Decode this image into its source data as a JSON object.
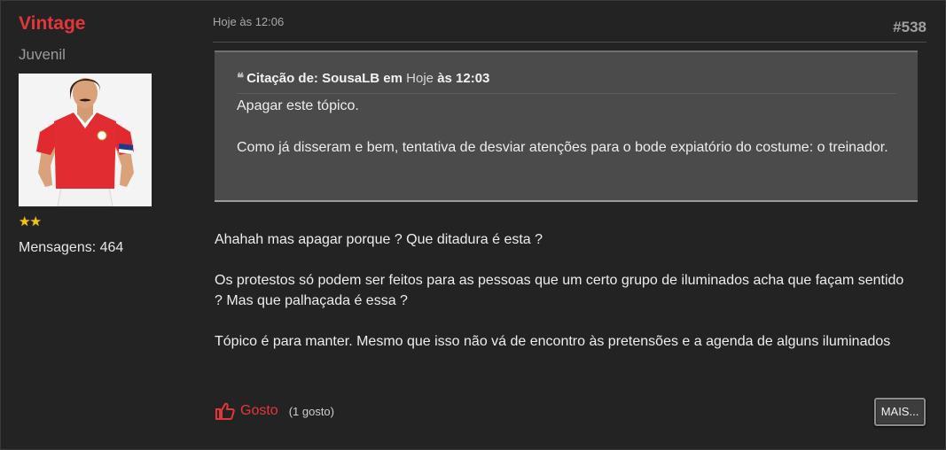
{
  "user": {
    "name": "Vintage",
    "rank": "Juvenil",
    "posts_label": "Mensagens: 464",
    "stars": "★★",
    "star_count": 2
  },
  "post": {
    "date": "Hoje às 12:06",
    "number": "#538"
  },
  "quote": {
    "prefix": "Citação de:",
    "author": "SousaLB",
    "em": "em",
    "date_link": "Hoje",
    "time": "às 12:03",
    "lines": [
      "Apagar este tópico.",
      "Como já disseram e bem, tentativa de desviar atenções para o bode expiatório do costume: o treinador."
    ]
  },
  "body": {
    "paragraphs": [
      "Ahahah mas apagar porque ? Que ditadura é esta ?",
      "Os protestos só podem ser feitos para as pessoas que um certo grupo de iluminados acha que façam sentido ? Mas que palhaçada é essa ?",
      "Tópico é para manter. Mesmo que isso não vá de encontro às pretensões e a agenda de alguns iluminados"
    ]
  },
  "actions": {
    "like_label": "Gosto",
    "like_count": "(1 gosto)",
    "more_label": "MAIS..."
  },
  "colors": {
    "accent_red": "#e3363b",
    "background": "#232323",
    "quote_bg": "#4b4b4b",
    "star_gold": "#f2c21a"
  }
}
